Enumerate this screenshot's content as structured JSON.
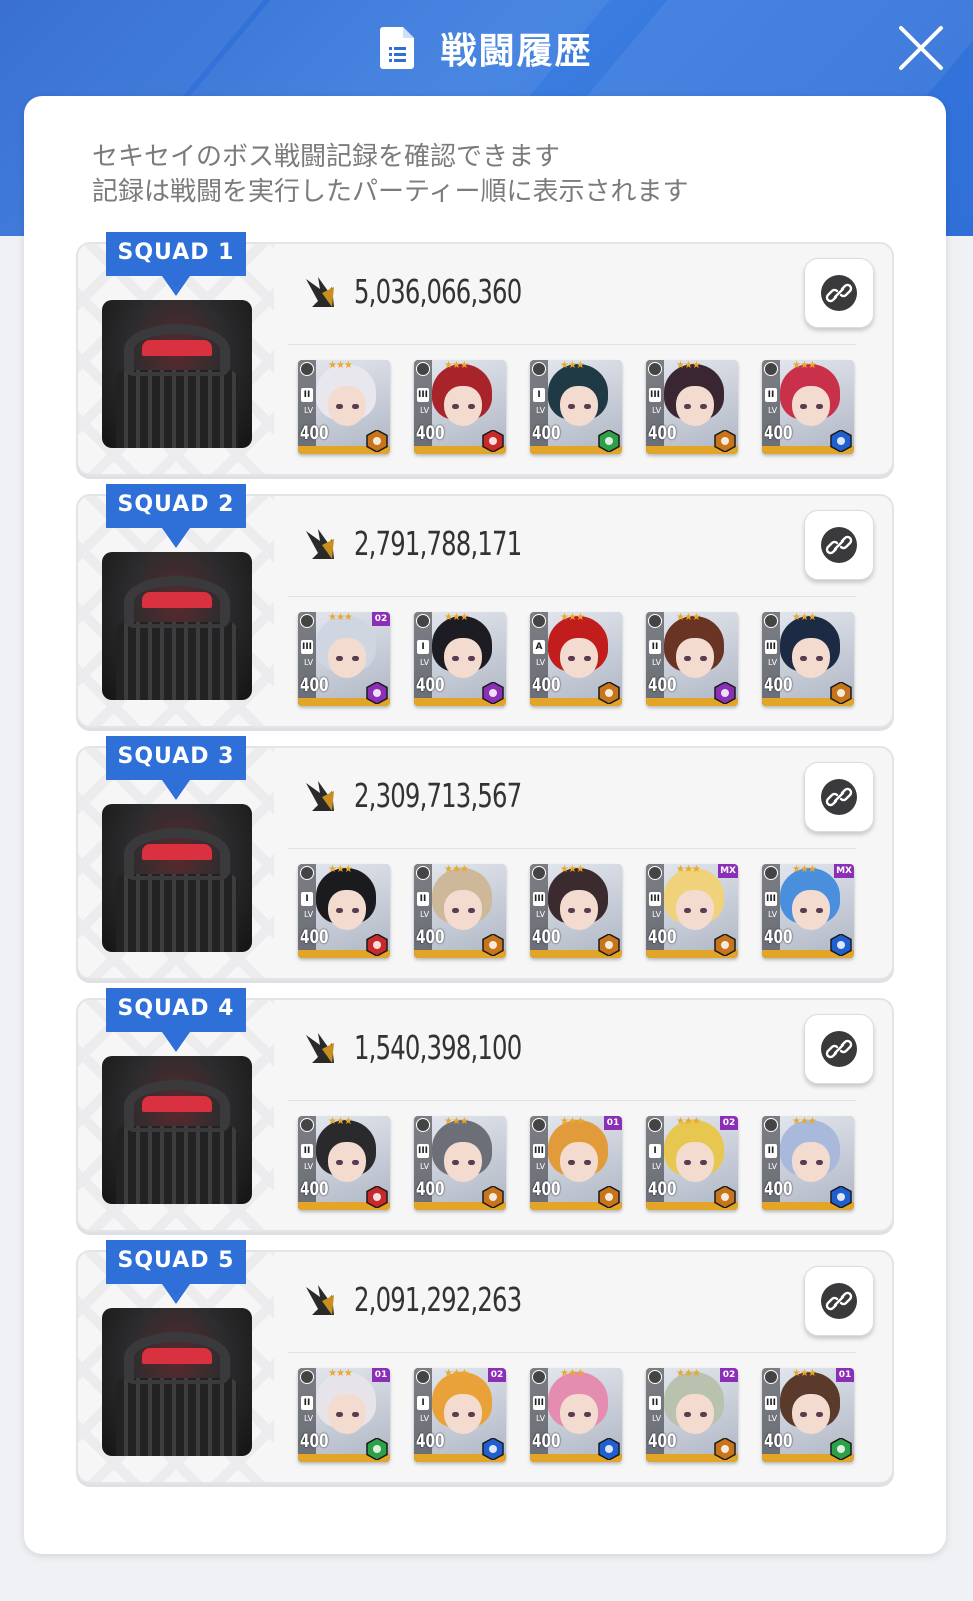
{
  "header": {
    "title": "戦闘履歴",
    "doc_icon": "document-icon",
    "close_icon": "close-icon"
  },
  "description": {
    "line1": "セキセイのボス戦闘記録を確認できます",
    "line2": "記録は戦闘を実行したパーティー順に表示されます"
  },
  "colors": {
    "header_blue": "#2f6fd8",
    "banner_blue": "#2f6fd8",
    "level_bar": "#e2a527",
    "element_fire": "#c82a2a",
    "element_iron": "#c7741b",
    "element_wind": "#2ea048",
    "element_water": "#1f5fd0",
    "element_electric": "#8a2fb6"
  },
  "squads": [
    {
      "label": "SQUAD 1",
      "score": "5,036,066,360",
      "link_icon": "link-icon",
      "members": [
        {
          "level": "400",
          "burst": "II",
          "element": "iron",
          "core": "",
          "hair": "#e9e7ee"
        },
        {
          "level": "400",
          "burst": "III",
          "element": "fire",
          "core": "",
          "hair": "#a8232a"
        },
        {
          "level": "400",
          "burst": "I",
          "element": "wind",
          "core": "",
          "hair": "#1f3a45"
        },
        {
          "level": "400",
          "burst": "III",
          "element": "iron",
          "core": "",
          "hair": "#3a2630"
        },
        {
          "level": "400",
          "burst": "II",
          "element": "water",
          "core": "",
          "hair": "#c9304a"
        }
      ]
    },
    {
      "label": "SQUAD 2",
      "score": "2,791,788,171",
      "link_icon": "link-icon",
      "members": [
        {
          "level": "400",
          "burst": "III",
          "element": "electric",
          "core": "02",
          "hair": "#cfd6e2"
        },
        {
          "level": "400",
          "burst": "I",
          "element": "electric",
          "core": "",
          "hair": "#1c1c22"
        },
        {
          "level": "400",
          "burst": "A",
          "element": "iron",
          "core": "",
          "hair": "#c21d1d"
        },
        {
          "level": "400",
          "burst": "II",
          "element": "electric",
          "core": "",
          "hair": "#6a3424"
        },
        {
          "level": "400",
          "burst": "III",
          "element": "iron",
          "core": "",
          "hair": "#1d2a44"
        }
      ]
    },
    {
      "label": "SQUAD 3",
      "score": "2,309,713,567",
      "link_icon": "link-icon",
      "members": [
        {
          "level": "400",
          "burst": "I",
          "element": "fire",
          "core": "",
          "hair": "#1a1a1f"
        },
        {
          "level": "400",
          "burst": "II",
          "element": "iron",
          "core": "",
          "hair": "#cdb99a"
        },
        {
          "level": "400",
          "burst": "III",
          "element": "iron",
          "core": "",
          "hair": "#3b2a2e"
        },
        {
          "level": "400",
          "burst": "III",
          "element": "iron",
          "core": "MX",
          "hair": "#f0d27a"
        },
        {
          "level": "400",
          "burst": "III",
          "element": "water",
          "core": "MX",
          "hair": "#4a8fde"
        }
      ]
    },
    {
      "label": "SQUAD 4",
      "score": "1,540,398,100",
      "link_icon": "link-icon",
      "members": [
        {
          "level": "400",
          "burst": "II",
          "element": "fire",
          "core": "",
          "hair": "#2a2a2c"
        },
        {
          "level": "400",
          "burst": "III",
          "element": "iron",
          "core": "",
          "hair": "#6c6e78"
        },
        {
          "level": "400",
          "burst": "III",
          "element": "iron",
          "core": "01",
          "hair": "#e19b3a"
        },
        {
          "level": "400",
          "burst": "I",
          "element": "iron",
          "core": "02",
          "hair": "#e8c750"
        },
        {
          "level": "400",
          "burst": "II",
          "element": "water",
          "core": "",
          "hair": "#a9b9dc"
        }
      ]
    },
    {
      "label": "SQUAD 5",
      "score": "2,091,292,263",
      "link_icon": "link-icon",
      "members": [
        {
          "level": "400",
          "burst": "II",
          "element": "wind",
          "core": "01",
          "hair": "#e6e4e8"
        },
        {
          "level": "400",
          "burst": "I",
          "element": "water",
          "core": "02",
          "hair": "#e9a23a"
        },
        {
          "level": "400",
          "burst": "III",
          "element": "water",
          "core": "",
          "hair": "#e58db0"
        },
        {
          "level": "400",
          "burst": "II",
          "element": "iron",
          "core": "02",
          "hair": "#b9c2ae"
        },
        {
          "level": "400",
          "burst": "III",
          "element": "wind",
          "core": "01",
          "hair": "#5a3a2a"
        }
      ]
    }
  ]
}
